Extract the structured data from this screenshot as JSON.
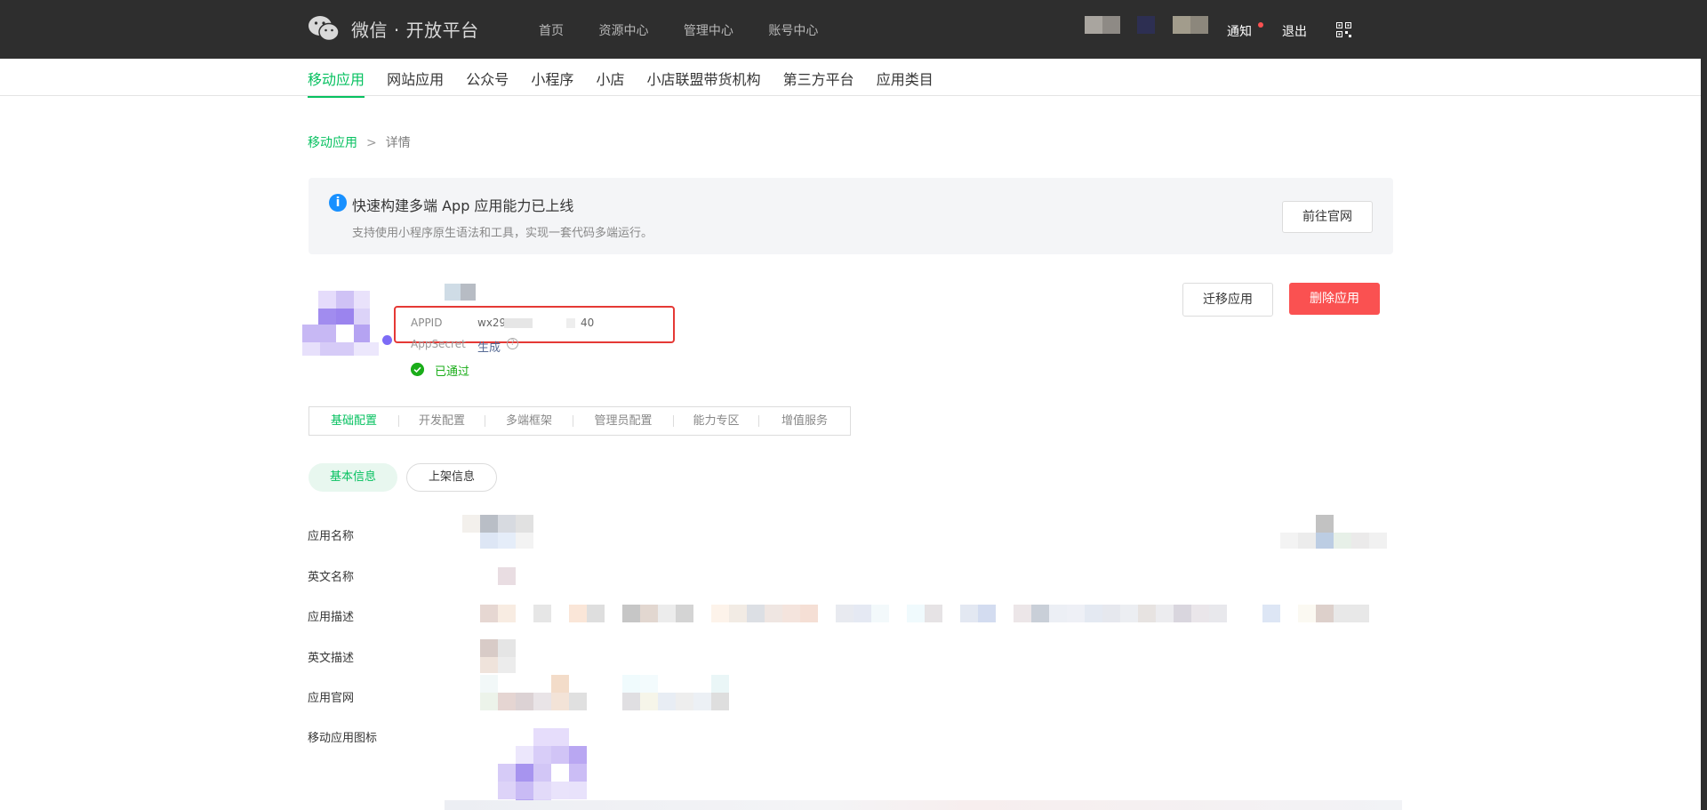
{
  "brand": {
    "title": "微信 · 开放平台"
  },
  "topnav": {
    "items": [
      "首页",
      "资源中心",
      "管理中心",
      "账号中心"
    ]
  },
  "user": {
    "notify": "通知",
    "logout": "退出"
  },
  "subnav": {
    "items": [
      "移动应用",
      "网站应用",
      "公众号",
      "小程序",
      "小店",
      "小店联盟带货机构",
      "第三方平台",
      "应用类目"
    ],
    "active_index": 0
  },
  "breadcrumb": {
    "parent": "移动应用",
    "separator": ">",
    "current": "详情"
  },
  "banner": {
    "icon": "i",
    "title": "快速构建多端 App 应用能力已上线",
    "description": "支持使用小程序原生语法和工具，实现一套代码多端运行。",
    "button": "前往官网"
  },
  "app": {
    "appid_label": "APPID",
    "appid_prefix": "wx29",
    "appid_suffix": "40",
    "appsecret_label": "AppSecret",
    "appsecret_action": "生成",
    "appsecret_info_icon": "?",
    "status": "已通过"
  },
  "actions": {
    "move": "迁移应用",
    "delete": "删除应用"
  },
  "tabs": {
    "items": [
      "基础配置",
      "开发配置",
      "多端框架",
      "管理员配置",
      "能力专区",
      "增值服务"
    ],
    "active_index": 0
  },
  "pills": {
    "basic": "基本信息",
    "listing": "上架信息"
  },
  "fields": {
    "app_name": "应用名称",
    "en_name": "英文名称",
    "app_desc": "应用描述",
    "en_desc": "英文描述",
    "website": "应用官网",
    "icon": "移动应用图标"
  },
  "colors": {
    "accent": "#07c160",
    "danger": "#fa5151",
    "topbar": "#2e2e2e",
    "highlight": "#e53935"
  }
}
